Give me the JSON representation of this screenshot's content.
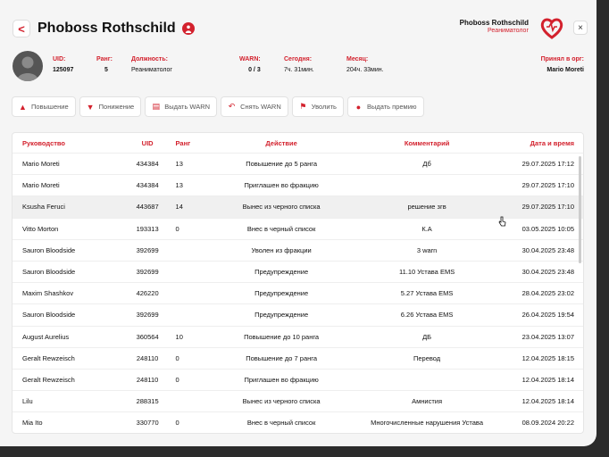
{
  "header": {
    "title": "Phoboss Rothschild",
    "back": "<",
    "close": "×"
  },
  "brand": {
    "name": "Phoboss Rothschild",
    "role": "Реаниматолог",
    "accent": "#d3212d"
  },
  "info": {
    "uid_label": "UID:",
    "uid": "125097",
    "rank_label": "Ранг:",
    "rank": "5",
    "position_label": "Должность:",
    "position": "Реаниматолог",
    "warn_label": "WARN:",
    "warn": "0 / 3",
    "today_label": "Сегодня:",
    "today": "7ч. 31мин.",
    "month_label": "Месяц:",
    "month": "204ч. 33мин.",
    "accepted_label": "Принял в орг:",
    "accepted": "Mario Moreti"
  },
  "actions": [
    {
      "icon": "chevron-up-icon",
      "glyph": "▲",
      "label": "Повышение"
    },
    {
      "icon": "chevron-down-icon",
      "glyph": "▼",
      "label": "Понижение"
    },
    {
      "icon": "doc-icon",
      "glyph": "▤",
      "label": "Выдать WARN"
    },
    {
      "icon": "undo-icon",
      "glyph": "↶",
      "label": "Снять WARN"
    },
    {
      "icon": "fire-icon",
      "glyph": "⚑",
      "label": "Уволить"
    },
    {
      "icon": "coin-icon",
      "glyph": "●",
      "label": "Выдать премию"
    }
  ],
  "table": {
    "columns": [
      "Руководство",
      "UID",
      "Ранг",
      "Действие",
      "Комментарий",
      "Дата и время"
    ],
    "rows": [
      [
        "Mario Moreti",
        "434384",
        "13",
        "Повышение до 5 ранга",
        "Дб",
        "29.07.2025 17:12"
      ],
      [
        "Mario Moreti",
        "434384",
        "13",
        "Приглашен во фракцию",
        "",
        "29.07.2025 17:10"
      ],
      [
        "Ksusha Feruci",
        "443687",
        "14",
        "Вынес из черного списка",
        "решение згв",
        "29.07.2025 17:10"
      ],
      [
        "Vitto Morton",
        "193313",
        "0",
        "Внес в черный список",
        "К.А",
        "03.05.2025 10:05"
      ],
      [
        "Sauron Bloodside",
        "392699",
        "",
        "Уволен из фракции",
        "3 warn",
        "30.04.2025 23:48"
      ],
      [
        "Sauron Bloodside",
        "392699",
        "",
        "Предупреждение",
        "11.10 Устава EMS",
        "30.04.2025 23:48"
      ],
      [
        "Maxim Shashkov",
        "426220",
        "",
        "Предупреждение",
        "5.27 Устава EMS",
        "28.04.2025 23:02"
      ],
      [
        "Sauron Bloodside",
        "392699",
        "",
        "Предупреждение",
        "6.26 Устава EMS",
        "26.04.2025 19:54"
      ],
      [
        "August Aurelius",
        "360564",
        "10",
        "Повышение до 10 ранга",
        "ДБ",
        "23.04.2025 13:07"
      ],
      [
        "Geralt Rewzeisch",
        "248110",
        "0",
        "Повышение до 7 ранга",
        "Перевод",
        "12.04.2025 18:15"
      ],
      [
        "Geralt Rewzeisch",
        "248110",
        "0",
        "Приглашен во фракцию",
        "",
        "12.04.2025 18:14"
      ],
      [
        "Lilu",
        "288315",
        "",
        "Вынес из черного списка",
        "Амнистия",
        "12.04.2025 18:14"
      ],
      [
        "Mia Ito",
        "330770",
        "0",
        "Внес в черный список",
        "Многочисленные нарушения Устава",
        "08.09.2024 20:22"
      ]
    ],
    "highlighted_row": 2
  }
}
